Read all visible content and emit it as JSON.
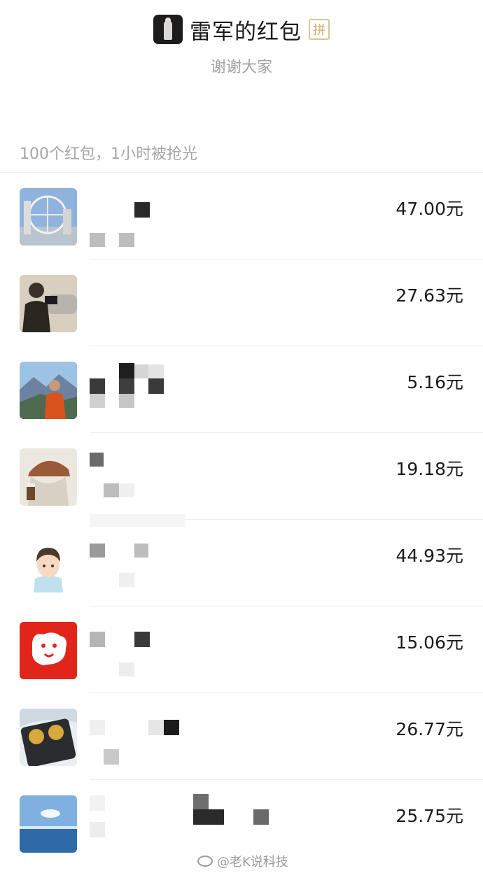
{
  "header": {
    "title": "雷军的红包",
    "pin_badge": "拼",
    "subtitle": "谢谢大家"
  },
  "summary": "100个红包，1小时被抢光",
  "list": [
    {
      "amount": "47.00元",
      "avatar_icon": "ferris-wheel-photo-avatar"
    },
    {
      "amount": "27.63元",
      "avatar_icon": "photographer-photo-avatar"
    },
    {
      "amount": "5.16元",
      "avatar_icon": "mountain-person-photo-avatar"
    },
    {
      "amount": "19.18元",
      "avatar_icon": "cartoon-hat-avatar"
    },
    {
      "amount": "44.93元",
      "avatar_icon": "cartoon-boy-avatar"
    },
    {
      "amount": "15.06元",
      "avatar_icon": "jd-dog-logo-avatar"
    },
    {
      "amount": "26.77元",
      "avatar_icon": "gold-coins-phone-avatar"
    },
    {
      "amount": "25.75元",
      "avatar_icon": "sea-sky-photo-avatar"
    }
  ],
  "watermark": "@老K说科技",
  "colors": {
    "title": "#1a1a1a",
    "muted": "#a3a3a3",
    "badge": "#c8ae72",
    "jd_red": "#e1251b"
  }
}
